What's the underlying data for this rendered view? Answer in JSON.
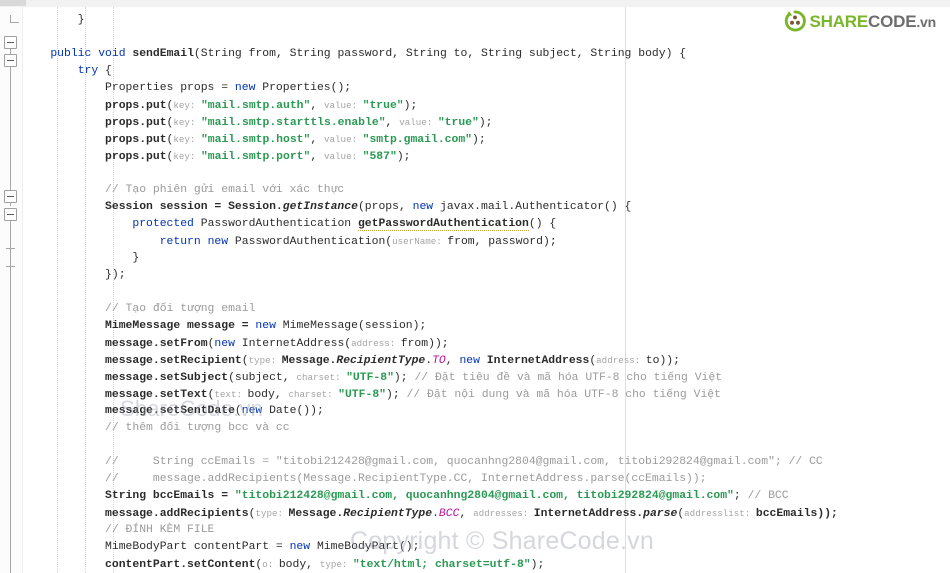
{
  "window": {
    "app": "java-code-editor",
    "top_strip_visible": true
  },
  "branding": {
    "logo_icon": "recycle-circle-icon",
    "text_share": "SHARE",
    "text_code": "CODE",
    "text_vn": ".vn"
  },
  "watermarks": {
    "primary": "ShareCode.vn",
    "copyright": "Copyright © ShareCode.vn"
  },
  "gutter": {
    "fold_markers": [
      "collapse",
      "collapse",
      "collapse",
      "collapse"
    ],
    "tick_markers": 2
  },
  "code": {
    "language": "Java",
    "lines": [
      {
        "id": 1,
        "tokens": [
          {
            "t": "        }",
            "c": "plain"
          }
        ]
      },
      {
        "id": 2,
        "tokens": []
      },
      {
        "id": 3,
        "tokens": [
          {
            "t": "    ",
            "c": "plain"
          },
          {
            "t": "public",
            "c": "kw"
          },
          {
            "t": " ",
            "c": "plain"
          },
          {
            "t": "void",
            "c": "kw"
          },
          {
            "t": " ",
            "c": "plain"
          },
          {
            "t": "sendEmail",
            "c": "plain b"
          },
          {
            "t": "(String from, String password, String to, String subject, String body) {",
            "c": "plain"
          }
        ]
      },
      {
        "id": 4,
        "tokens": [
          {
            "t": "        ",
            "c": "plain"
          },
          {
            "t": "try",
            "c": "kw"
          },
          {
            "t": " {",
            "c": "plain"
          }
        ]
      },
      {
        "id": 5,
        "tokens": [
          {
            "t": "            Properties props = ",
            "c": "plain"
          },
          {
            "t": "new",
            "c": "kw"
          },
          {
            "t": " Properties();",
            "c": "plain"
          }
        ]
      },
      {
        "id": 6,
        "tokens": [
          {
            "t": "            props.put",
            "c": "plain b"
          },
          {
            "t": "(",
            "c": "plain"
          },
          {
            "t": "key: ",
            "c": "hint"
          },
          {
            "t": "\"mail.smtp.auth\"",
            "c": "str b"
          },
          {
            "t": ", ",
            "c": "plain"
          },
          {
            "t": "value: ",
            "c": "hint"
          },
          {
            "t": "\"true\"",
            "c": "str b"
          },
          {
            "t": ");",
            "c": "plain"
          }
        ]
      },
      {
        "id": 7,
        "tokens": [
          {
            "t": "            props.put",
            "c": "plain b"
          },
          {
            "t": "(",
            "c": "plain"
          },
          {
            "t": "key: ",
            "c": "hint"
          },
          {
            "t": "\"mail.smtp.starttls.enable\"",
            "c": "str b"
          },
          {
            "t": ", ",
            "c": "plain"
          },
          {
            "t": "value: ",
            "c": "hint"
          },
          {
            "t": "\"true\"",
            "c": "str b"
          },
          {
            "t": ");",
            "c": "plain"
          }
        ]
      },
      {
        "id": 8,
        "tokens": [
          {
            "t": "            props.put",
            "c": "plain b"
          },
          {
            "t": "(",
            "c": "plain"
          },
          {
            "t": "key: ",
            "c": "hint"
          },
          {
            "t": "\"mail.smtp.host\"",
            "c": "str b"
          },
          {
            "t": ", ",
            "c": "plain"
          },
          {
            "t": "value: ",
            "c": "hint"
          },
          {
            "t": "\"smtp.gmail.com\"",
            "c": "str b"
          },
          {
            "t": ");",
            "c": "plain"
          }
        ]
      },
      {
        "id": 9,
        "tokens": [
          {
            "t": "            props.put",
            "c": "plain b"
          },
          {
            "t": "(",
            "c": "plain"
          },
          {
            "t": "key: ",
            "c": "hint"
          },
          {
            "t": "\"mail.smtp.port\"",
            "c": "str b"
          },
          {
            "t": ", ",
            "c": "plain"
          },
          {
            "t": "value: ",
            "c": "hint"
          },
          {
            "t": "\"587\"",
            "c": "str b"
          },
          {
            "t": ");",
            "c": "plain"
          }
        ]
      },
      {
        "id": 10,
        "tokens": []
      },
      {
        "id": 11,
        "tokens": [
          {
            "t": "            // Tạo phiên gửi email với xác thực",
            "c": "cmt"
          }
        ]
      },
      {
        "id": 12,
        "tokens": [
          {
            "t": "            Session session = Session.",
            "c": "plain b"
          },
          {
            "t": "getInstance",
            "c": "plain b i"
          },
          {
            "t": "(props, ",
            "c": "plain"
          },
          {
            "t": "new",
            "c": "kw"
          },
          {
            "t": " javax.mail.Authenticator() {",
            "c": "plain"
          }
        ]
      },
      {
        "id": 13,
        "tokens": [
          {
            "t": "                ",
            "c": "plain"
          },
          {
            "t": "protected",
            "c": "kw"
          },
          {
            "t": " PasswordAuthentication ",
            "c": "plain"
          },
          {
            "t": "getPasswordAuthentication",
            "c": "plain b err"
          },
          {
            "t": "() {",
            "c": "plain"
          }
        ]
      },
      {
        "id": 14,
        "tokens": [
          {
            "t": "                    ",
            "c": "plain"
          },
          {
            "t": "return new",
            "c": "kw"
          },
          {
            "t": " PasswordAuthentication",
            "c": "plain"
          },
          {
            "t": "(",
            "c": "plain"
          },
          {
            "t": "userName: ",
            "c": "hint"
          },
          {
            "t": "from, password);",
            "c": "plain"
          }
        ]
      },
      {
        "id": 15,
        "tokens": [
          {
            "t": "                }",
            "c": "plain"
          }
        ]
      },
      {
        "id": 16,
        "tokens": [
          {
            "t": "            });",
            "c": "plain"
          }
        ]
      },
      {
        "id": 17,
        "tokens": []
      },
      {
        "id": 18,
        "tokens": [
          {
            "t": "            // Tạo đối tượng email",
            "c": "cmt"
          }
        ]
      },
      {
        "id": 19,
        "tokens": [
          {
            "t": "            MimeMessage message = ",
            "c": "plain b"
          },
          {
            "t": "new",
            "c": "kw"
          },
          {
            "t": " MimeMessage(session);",
            "c": "plain"
          }
        ]
      },
      {
        "id": 20,
        "tokens": [
          {
            "t": "            message.setFrom",
            "c": "plain b"
          },
          {
            "t": "(",
            "c": "plain"
          },
          {
            "t": "new",
            "c": "kw"
          },
          {
            "t": " InternetAddress",
            "c": "plain"
          },
          {
            "t": "(",
            "c": "plain"
          },
          {
            "t": "address: ",
            "c": "hint"
          },
          {
            "t": "from));",
            "c": "plain"
          }
        ]
      },
      {
        "id": 21,
        "tokens": [
          {
            "t": "            message.setRecipient",
            "c": "plain b"
          },
          {
            "t": "(",
            "c": "plain"
          },
          {
            "t": "type: ",
            "c": "hint"
          },
          {
            "t": "Message.",
            "c": "plain b"
          },
          {
            "t": "RecipientType",
            "c": "plain b i"
          },
          {
            "t": ".",
            "c": "plain"
          },
          {
            "t": "TO",
            "c": "stat"
          },
          {
            "t": ", ",
            "c": "plain"
          },
          {
            "t": "new",
            "c": "kw"
          },
          {
            "t": " InternetAddress",
            "c": "plain b"
          },
          {
            "t": "(",
            "c": "plain"
          },
          {
            "t": "address: ",
            "c": "hint"
          },
          {
            "t": "to));",
            "c": "plain"
          }
        ]
      },
      {
        "id": 22,
        "tokens": [
          {
            "t": "            message.setSubject",
            "c": "plain b"
          },
          {
            "t": "(subject, ",
            "c": "plain"
          },
          {
            "t": "charset: ",
            "c": "hint"
          },
          {
            "t": "\"UTF-8\"",
            "c": "str b"
          },
          {
            "t": "); ",
            "c": "plain"
          },
          {
            "t": "// Đặt tiêu đề và mã hóa UTF-8 cho tiếng Việt",
            "c": "cmt"
          }
        ]
      },
      {
        "id": 23,
        "tokens": [
          {
            "t": "            message.setText",
            "c": "plain b"
          },
          {
            "t": "(",
            "c": "plain"
          },
          {
            "t": "text: ",
            "c": "hint"
          },
          {
            "t": "body, ",
            "c": "plain"
          },
          {
            "t": "charset: ",
            "c": "hint"
          },
          {
            "t": "\"UTF-8\"",
            "c": "str b"
          },
          {
            "t": "); ",
            "c": "plain"
          },
          {
            "t": "// Đặt nội dung và mã hóa UTF-8 cho tiếng Việt",
            "c": "cmt"
          }
        ]
      },
      {
        "id": 24,
        "tokens": [
          {
            "t": "            message.setSentDate",
            "c": "plain b"
          },
          {
            "t": "(",
            "c": "plain"
          },
          {
            "t": "new",
            "c": "kw"
          },
          {
            "t": " Date());",
            "c": "plain"
          }
        ]
      },
      {
        "id": 25,
        "tokens": [
          {
            "t": "            // thêm đối tượng bcc và cc",
            "c": "cmt"
          }
        ]
      },
      {
        "id": 26,
        "tokens": []
      },
      {
        "id": 27,
        "tokens": [
          {
            "t": "            //     String ccEmails = \"titobi212428@gmail.com, quocanhng2804@gmail.com, titobi292824@gmail.com\"; // CC",
            "c": "cmt"
          }
        ]
      },
      {
        "id": 28,
        "tokens": [
          {
            "t": "            //     message.addRecipients(Message.RecipientType.CC, InternetAddress.parse(ccEmails));",
            "c": "cmt"
          }
        ]
      },
      {
        "id": 29,
        "tokens": [
          {
            "t": "            String bccEmails = ",
            "c": "plain b"
          },
          {
            "t": "\"titobi212428@gmail.com, quocanhng2804@gmail.com, titobi292824@gmail.com\"",
            "c": "str b"
          },
          {
            "t": "; ",
            "c": "plain"
          },
          {
            "t": "// BCC",
            "c": "cmt"
          }
        ]
      },
      {
        "id": 30,
        "tokens": [
          {
            "t": "            message.addRecipients",
            "c": "plain b"
          },
          {
            "t": "(",
            "c": "plain"
          },
          {
            "t": "type: ",
            "c": "hint"
          },
          {
            "t": "Message.",
            "c": "plain b"
          },
          {
            "t": "RecipientType",
            "c": "plain b i"
          },
          {
            "t": ".",
            "c": "plain"
          },
          {
            "t": "BCC",
            "c": "stat"
          },
          {
            "t": ", ",
            "c": "plain"
          },
          {
            "t": "addresses: ",
            "c": "hint"
          },
          {
            "t": "InternetAddress.",
            "c": "plain b"
          },
          {
            "t": "parse",
            "c": "plain b i"
          },
          {
            "t": "(",
            "c": "plain"
          },
          {
            "t": "addresslist: ",
            "c": "hint"
          },
          {
            "t": "bccEmails));",
            "c": "plain b"
          }
        ]
      },
      {
        "id": 31,
        "tokens": [
          {
            "t": "            // ĐÍNH KÈM FILE",
            "c": "cmt"
          }
        ]
      },
      {
        "id": 32,
        "tokens": [
          {
            "t": "            MimeBodyPart contentPart = ",
            "c": "plain"
          },
          {
            "t": "new",
            "c": "kw"
          },
          {
            "t": " MimeBodyPart();",
            "c": "plain"
          }
        ]
      },
      {
        "id": 33,
        "tokens": [
          {
            "t": "            contentPart.setContent",
            "c": "plain b"
          },
          {
            "t": "(",
            "c": "plain"
          },
          {
            "t": "o: ",
            "c": "hint"
          },
          {
            "t": "body, ",
            "c": "plain"
          },
          {
            "t": "type: ",
            "c": "hint"
          },
          {
            "t": "\"text/html; charset=utf-8\"",
            "c": "str b"
          },
          {
            "t": ");",
            "c": "plain"
          }
        ]
      }
    ]
  }
}
